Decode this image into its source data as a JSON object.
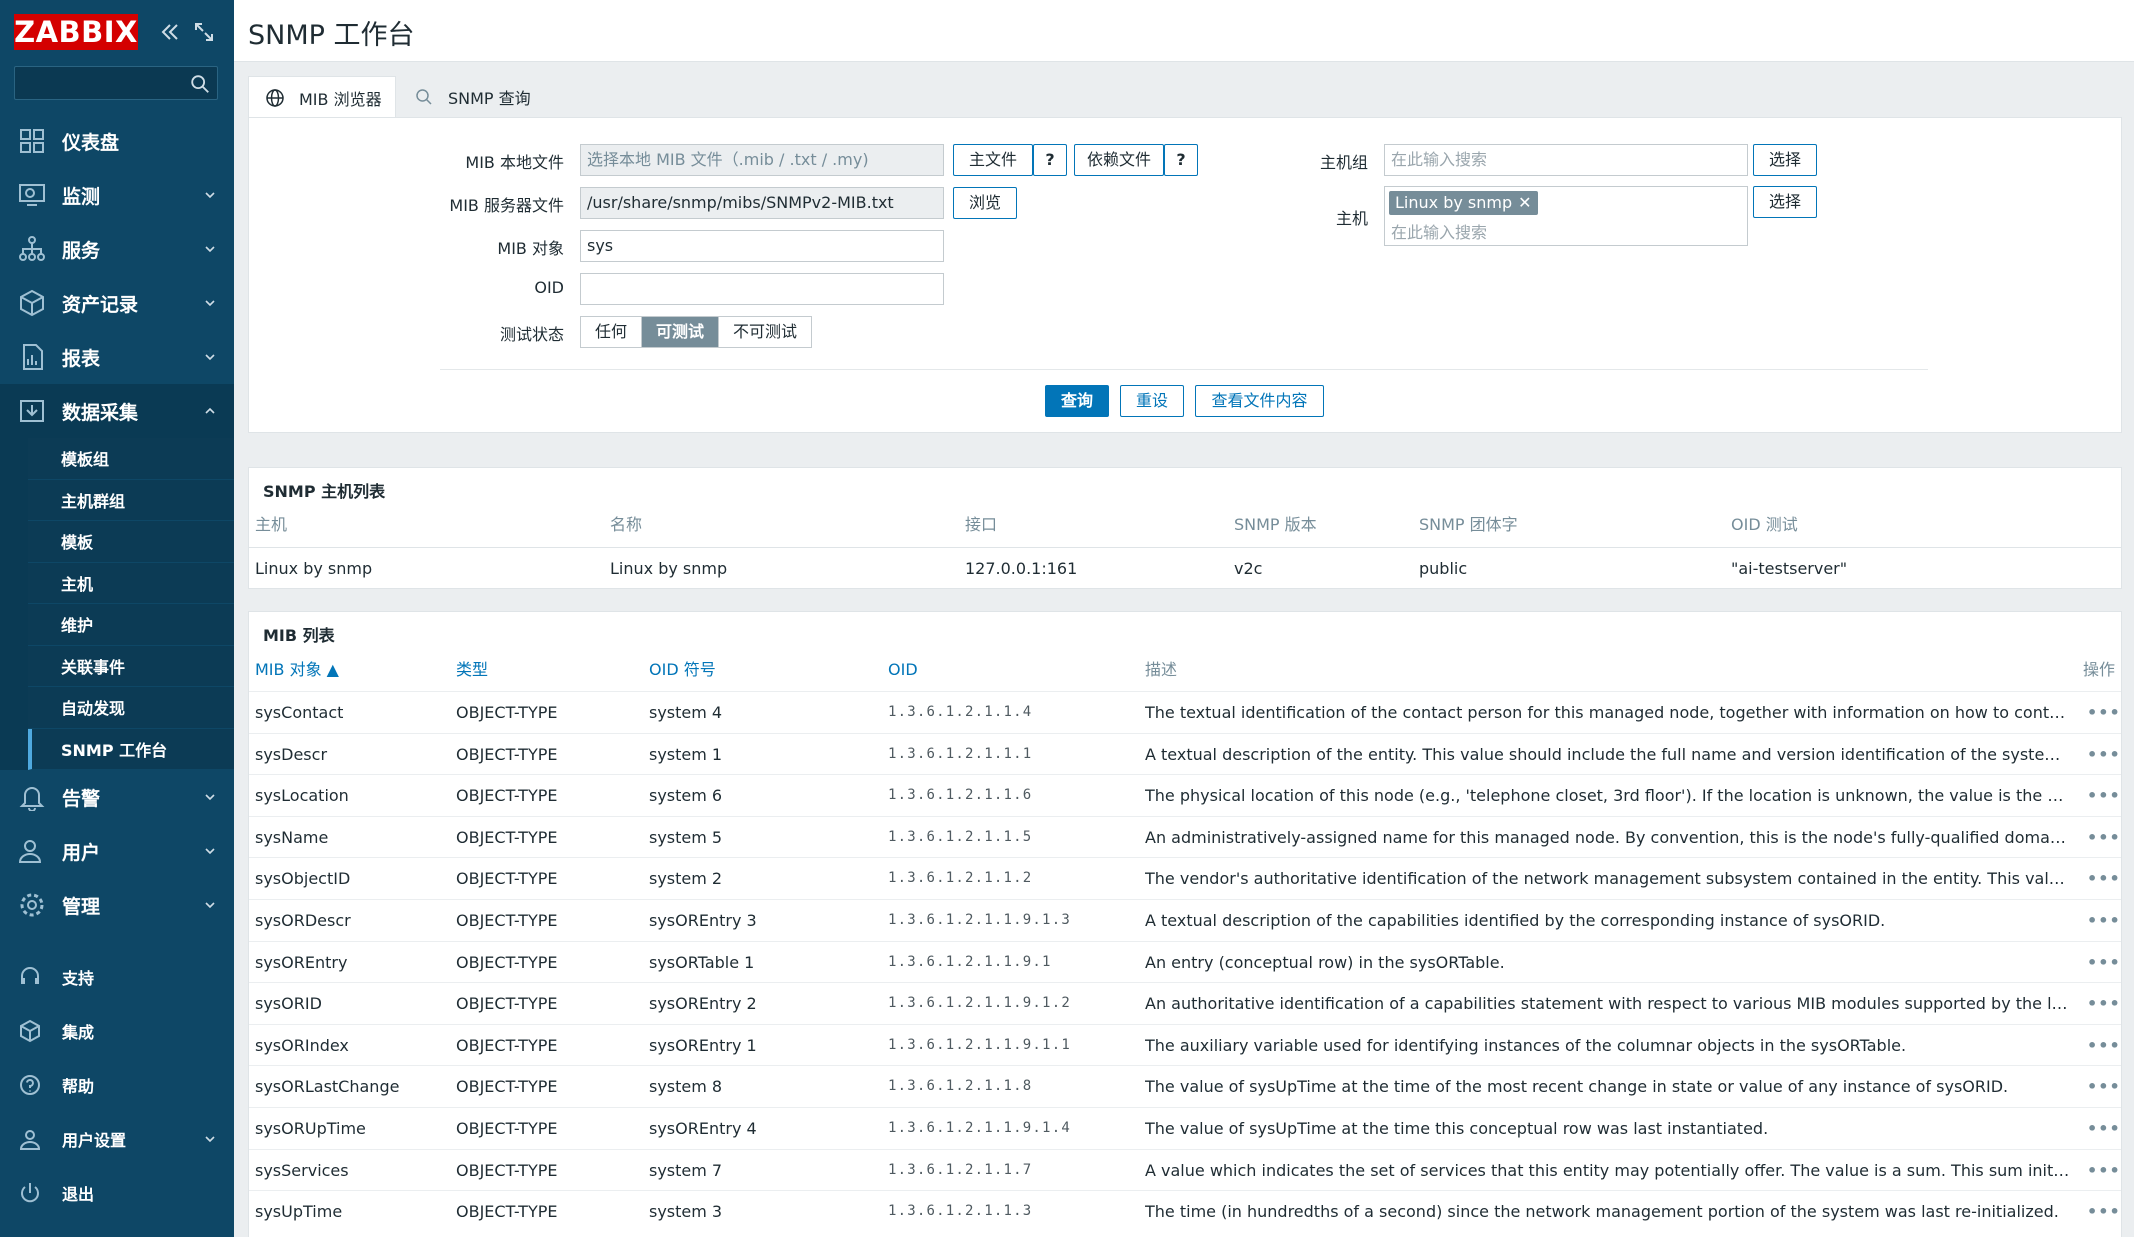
{
  "sidebar": {
    "logo": "ZABBIX",
    "search": {
      "value": "",
      "placeholder": ""
    },
    "items": [
      {
        "label": "仪表盘",
        "icon": "dashboard-icon",
        "has_children": false
      },
      {
        "label": "监测",
        "icon": "monitoring-icon",
        "has_children": true
      },
      {
        "label": "服务",
        "icon": "services-icon",
        "has_children": true
      },
      {
        "label": "资产记录",
        "icon": "inventory-icon",
        "has_children": true
      },
      {
        "label": "报表",
        "icon": "reports-icon",
        "has_children": true
      },
      {
        "label": "数据采集",
        "icon": "data-collection-icon",
        "has_children": true,
        "expanded": true
      }
    ],
    "submenu": [
      "模板组",
      "主机群组",
      "模板",
      "主机",
      "维护",
      "关联事件",
      "自动发现",
      "SNMP 工作台"
    ],
    "submenu_selected": "SNMP 工作台",
    "items_after": [
      {
        "label": "告警",
        "icon": "alerts-icon"
      },
      {
        "label": "用户",
        "icon": "users-icon"
      },
      {
        "label": "管理",
        "icon": "administration-icon"
      }
    ],
    "bottom": [
      {
        "label": "支持",
        "icon": "support-icon"
      },
      {
        "label": "集成",
        "icon": "integrations-icon"
      },
      {
        "label": "帮助",
        "icon": "help-icon"
      },
      {
        "label": "用户设置",
        "icon": "user-settings-icon"
      },
      {
        "label": "退出",
        "icon": "sign-out-icon"
      }
    ]
  },
  "header": {
    "title": "SNMP 工作台"
  },
  "filter": {
    "tabs": [
      {
        "label": "MIB 浏览器",
        "icon": "globe-icon",
        "active": true
      },
      {
        "label": "SNMP 查询",
        "icon": "search-icon",
        "active": false
      }
    ],
    "mib_local_file": {
      "label": "MIB 本地文件",
      "placeholder": "选择本地 MIB 文件（.mib / .txt / .my)",
      "main_btn": "主文件",
      "help": "?",
      "dep_btn": "依赖文件"
    },
    "mib_server_file": {
      "label": "MIB 服务器文件",
      "value": "/usr/share/snmp/mibs/SNMPv2-MIB.txt",
      "browse": "浏览"
    },
    "mib_object": {
      "label": "MIB 对象",
      "value": "sys"
    },
    "oid": {
      "label": "OID",
      "value": ""
    },
    "test_status": {
      "label": "测试状态",
      "options": [
        "任何",
        "可测试",
        "不可测试"
      ],
      "selected": "可测试"
    },
    "host_group": {
      "label": "主机组",
      "placeholder": "在此输入搜索",
      "select": "选择"
    },
    "host": {
      "label": "主机",
      "tag": "Linux by snmp",
      "placeholder": "在此输入搜索",
      "select": "选择"
    },
    "buttons": {
      "query": "查询",
      "reset": "重设",
      "view": "查看文件内容"
    }
  },
  "hosts_table": {
    "title": "SNMP 主机列表",
    "headers": [
      "主机",
      "名称",
      "接口",
      "SNMP 版本",
      "SNMP 团体字",
      "OID 测试"
    ],
    "rows": [
      [
        "Linux by snmp",
        "Linux by snmp",
        "127.0.0.1:161",
        "v2c",
        "public",
        "\"ai-testserver\""
      ]
    ]
  },
  "mib_table": {
    "title": "MIB 列表",
    "headers": [
      "MIB 对象 ▲",
      "类型",
      "OID 符号",
      "OID",
      "描述",
      "操作"
    ],
    "rows": [
      [
        "sysContact",
        "OBJECT-TYPE",
        "system 4",
        "1.3.6.1.2.1.1.4",
        "The textual identification of the contact person for this managed node, together with information on how to contact this person. ..."
      ],
      [
        "sysDescr",
        "OBJECT-TYPE",
        "system 1",
        "1.3.6.1.2.1.1.1",
        "A textual description of the entity. This value should include the full name and version identification of the system's hardware ty..."
      ],
      [
        "sysLocation",
        "OBJECT-TYPE",
        "system 6",
        "1.3.6.1.2.1.1.6",
        "The physical location of this node (e.g., 'telephone closet, 3rd floor'). If the location is unknown, the value is the zero-length stri..."
      ],
      [
        "sysName",
        "OBJECT-TYPE",
        "system 5",
        "1.3.6.1.2.1.1.5",
        "An administratively-assigned name for this managed node. By convention, this is the node's fully-qualified domain name. If the ..."
      ],
      [
        "sysObjectID",
        "OBJECT-TYPE",
        "system 2",
        "1.3.6.1.2.1.1.2",
        "The vendor's authoritative identification of the network management subsystem contained in the entity. This value is allocated ..."
      ],
      [
        "sysORDescr",
        "OBJECT-TYPE",
        "sysOREntry 3",
        "1.3.6.1.2.1.1.9.1.3",
        "A textual description of the capabilities identified by the corresponding instance of sysORID."
      ],
      [
        "sysOREntry",
        "OBJECT-TYPE",
        "sysORTable 1",
        "1.3.6.1.2.1.1.9.1",
        "An entry (conceptual row) in the sysORTable."
      ],
      [
        "sysORID",
        "OBJECT-TYPE",
        "sysOREntry 2",
        "1.3.6.1.2.1.1.9.1.2",
        "An authoritative identification of a capabilities statement with respect to various MIB modules supported by the local SNMP ap..."
      ],
      [
        "sysORIndex",
        "OBJECT-TYPE",
        "sysOREntry 1",
        "1.3.6.1.2.1.1.9.1.1",
        "The auxiliary variable used for identifying instances of the columnar objects in the sysORTable."
      ],
      [
        "sysORLastChange",
        "OBJECT-TYPE",
        "system 8",
        "1.3.6.1.2.1.1.8",
        "The value of sysUpTime at the time of the most recent change in state or value of any instance of sysORID."
      ],
      [
        "sysORUpTime",
        "OBJECT-TYPE",
        "sysOREntry 4",
        "1.3.6.1.2.1.1.9.1.4",
        "The value of sysUpTime at the time this conceptual row was last instantiated."
      ],
      [
        "sysServices",
        "OBJECT-TYPE",
        "system 7",
        "1.3.6.1.2.1.1.7",
        "A value which indicates the set of services that this entity may potentially offer. The value is a sum. This sum initially takes the ..."
      ],
      [
        "sysUpTime",
        "OBJECT-TYPE",
        "system 3",
        "1.3.6.1.2.1.1.3",
        "The time (in hundredths of a second) since the network management portion of the system was last re-initialized."
      ]
    ],
    "action": "•••"
  }
}
